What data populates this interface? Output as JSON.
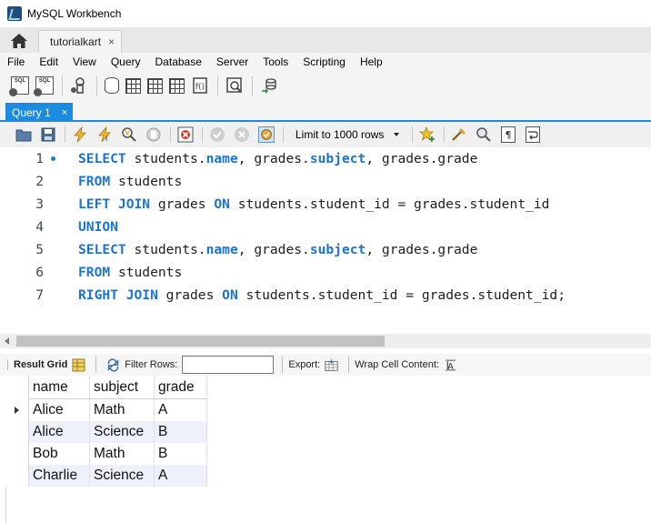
{
  "window": {
    "title": "MySQL Workbench"
  },
  "connection_tab": {
    "label": "tutorialkart",
    "close": "×"
  },
  "menu": [
    "File",
    "Edit",
    "View",
    "Query",
    "Database",
    "Server",
    "Tools",
    "Scripting",
    "Help"
  ],
  "main_toolbar": {
    "icons": [
      "new-sql-tab-icon",
      "open-sql-script-icon",
      "inspector-icon",
      "create-schema-icon",
      "create-table-icon",
      "create-view-icon",
      "create-procedure-icon",
      "create-function-icon",
      "search-table-data-icon",
      "reconnect-icon"
    ]
  },
  "query_tab": {
    "label": "Query 1",
    "close": "×"
  },
  "editor_toolbar": {
    "limit_label": "Limit to 1000 rows",
    "icons": [
      "open-file-icon",
      "save-icon",
      "execute-icon",
      "execute-current-icon",
      "explain-icon",
      "stop-icon",
      "toggle-error-icon",
      "commit-icon",
      "rollback-icon",
      "autocommit-icon",
      "bookmark-icon",
      "beautify-icon",
      "find-icon",
      "invisible-chars-icon",
      "wrap-icon"
    ]
  },
  "code": [
    {
      "n": "1",
      "marker": true,
      "tokens": [
        [
          "kw",
          "SELECT"
        ],
        [
          "tx",
          " students."
        ],
        [
          "fn",
          "name"
        ],
        [
          "tx",
          ", grades."
        ],
        [
          "fn",
          "subject"
        ],
        [
          "tx",
          ", grades.grade"
        ]
      ]
    },
    {
      "n": "2",
      "marker": false,
      "tokens": [
        [
          "kw",
          "FROM"
        ],
        [
          "tx",
          " students"
        ]
      ]
    },
    {
      "n": "3",
      "marker": false,
      "tokens": [
        [
          "kw",
          "LEFT JOIN"
        ],
        [
          "tx",
          " grades "
        ],
        [
          "kw",
          "ON"
        ],
        [
          "tx",
          " students.student_id = grades.student_id"
        ]
      ]
    },
    {
      "n": "4",
      "marker": false,
      "tokens": [
        [
          "kw",
          "UNION"
        ]
      ]
    },
    {
      "n": "5",
      "marker": false,
      "tokens": [
        [
          "kw",
          "SELECT"
        ],
        [
          "tx",
          " students."
        ],
        [
          "fn",
          "name"
        ],
        [
          "tx",
          ", grades."
        ],
        [
          "fn",
          "subject"
        ],
        [
          "tx",
          ", grades.grade"
        ]
      ]
    },
    {
      "n": "6",
      "marker": false,
      "tokens": [
        [
          "kw",
          "FROM"
        ],
        [
          "tx",
          " students"
        ]
      ]
    },
    {
      "n": "7",
      "marker": false,
      "tokens": [
        [
          "kw",
          "RIGHT JOIN"
        ],
        [
          "tx",
          " grades "
        ],
        [
          "kw",
          "ON"
        ],
        [
          "tx",
          " students.student_id = grades.student_id;"
        ]
      ]
    }
  ],
  "result_toolbar": {
    "result_grid": "Result Grid",
    "filter_rows": "Filter Rows:",
    "export": "Export:",
    "wrap_cell": "Wrap Cell Content:"
  },
  "result": {
    "columns": [
      "name",
      "subject",
      "grade"
    ],
    "rows": [
      [
        "Alice",
        "Math",
        "A"
      ],
      [
        "Alice",
        "Science",
        "B"
      ],
      [
        "Bob",
        "Math",
        "B"
      ],
      [
        "Charlie",
        "Science",
        "A"
      ]
    ]
  },
  "colors": {
    "accent": "#1c8ce3",
    "keyword": "#1a73d6",
    "alt_row": "#eef1fb"
  }
}
